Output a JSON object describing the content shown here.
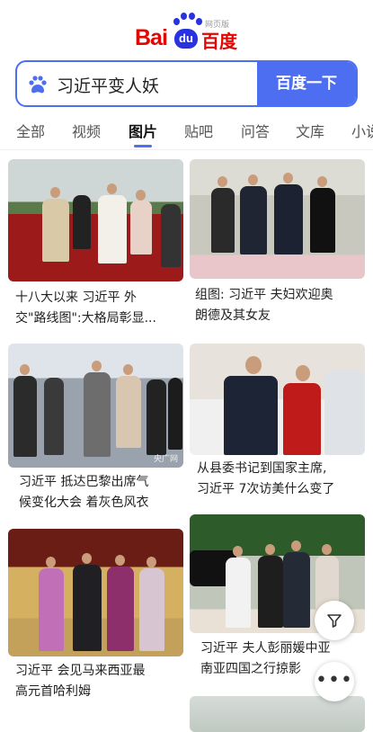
{
  "logo": {
    "left": "Bai",
    "badge": "du",
    "right": "百度",
    "sub": "网页版"
  },
  "search": {
    "query": "习近平变人妖",
    "button": "百度一下"
  },
  "tabs": [
    {
      "label": "全部"
    },
    {
      "label": "视频"
    },
    {
      "label": "图片"
    },
    {
      "label": "贴吧"
    },
    {
      "label": "问答"
    },
    {
      "label": "文库"
    },
    {
      "label": "小说"
    }
  ],
  "active_tab": "图片",
  "results": [
    {
      "caption_a": "十八大以来 习近平 外",
      "caption_b": "交\"路线图\":大格局彰显..."
    },
    {
      "caption_a": "组图: 习近平 夫妇欢迎奥",
      "caption_b": "朗德及其女友"
    },
    {
      "caption_a": "习近平 抵达巴黎出席气",
      "caption_b": "候变化大会 着灰色风衣",
      "watermark": "央广网"
    },
    {
      "caption_a": "从县委书记到国家主席,",
      "caption_b": "习近平 7次访美什么变了"
    },
    {
      "caption_a": "习近平 会见马来西亚最",
      "caption_b": "高元首哈利姆"
    },
    {
      "caption_a": "习近平 夫人彭丽媛中亚",
      "caption_b": "南亚四国之行掠影"
    }
  ],
  "float_buttons": {
    "filter": "filter-icon",
    "more": "more-icon"
  }
}
